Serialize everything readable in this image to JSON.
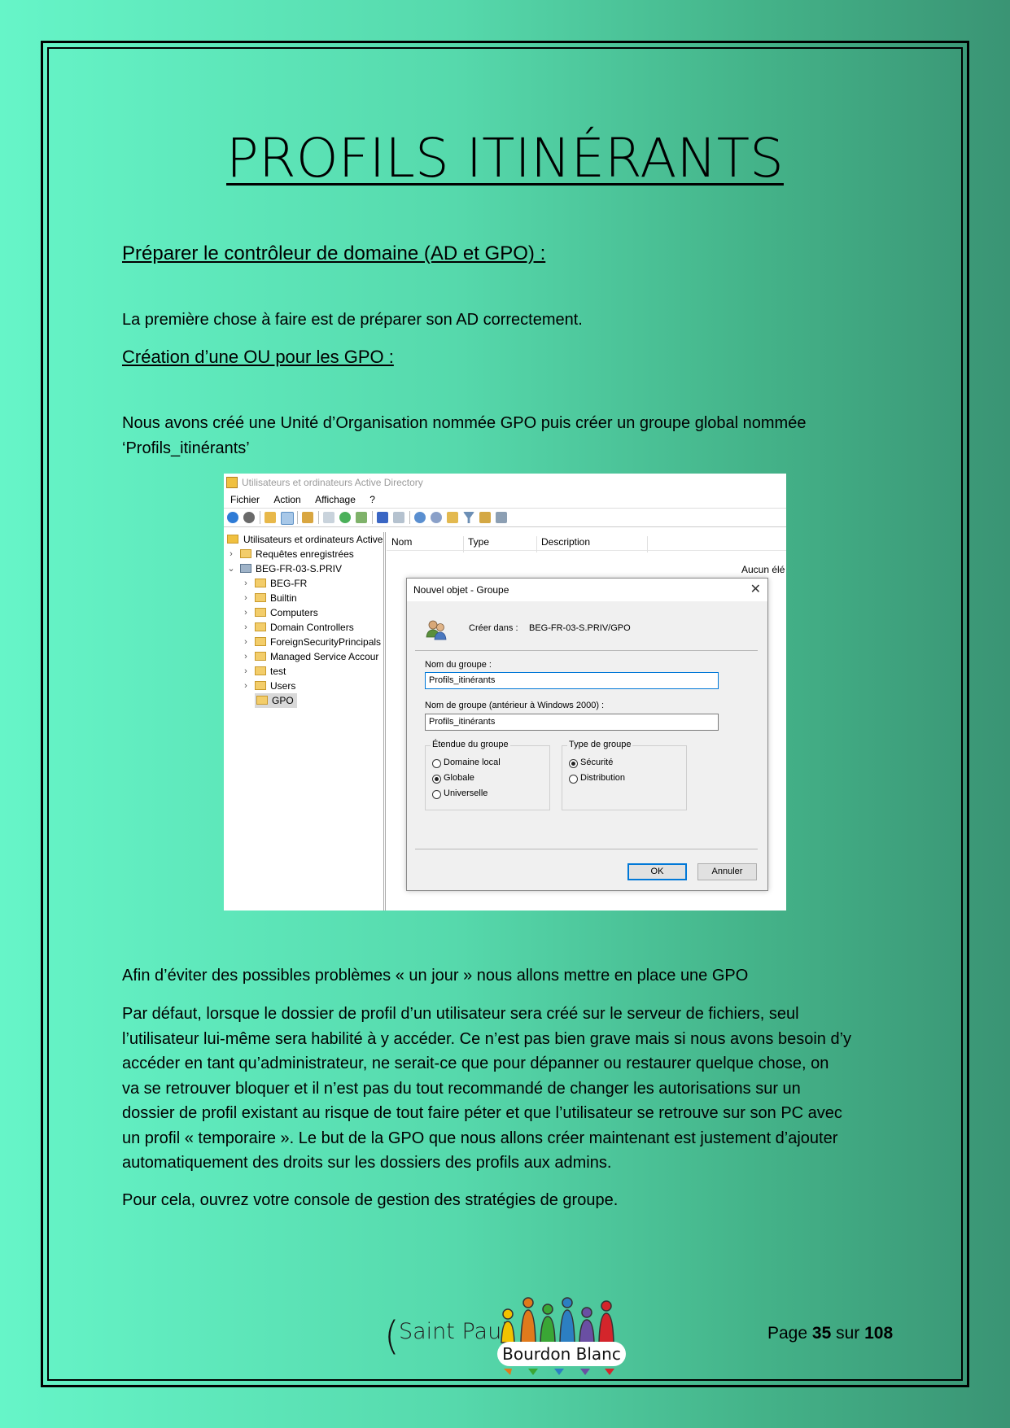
{
  "title": "PROFILS ITINÉRANTS",
  "section_heading": "Préparer le contrôleur de domaine (AD et GPO) :",
  "intro": "La première chose à faire est de préparer son AD correctement.",
  "sub_heading": "Création d’une OU pour les GPO :",
  "ou_text_line1": "Nous avons créé une Unité d’Organisation nommée GPO puis créer un groupe global nommée",
  "ou_text_line2": "‘Profils_itinérants’",
  "screenshot": {
    "window_title": "Utilisateurs et ordinateurs Active Directory",
    "menu": [
      "Fichier",
      "Action",
      "Affichage",
      "?"
    ],
    "tree": {
      "root": "Utilisateurs et ordinateurs Active",
      "saved_queries": "Requêtes enregistrées",
      "domain": "BEG-FR-03-S.PRIV",
      "children": [
        "BEG-FR",
        "Builtin",
        "Computers",
        "Domain Controllers",
        "ForeignSecurityPrincipals",
        "Managed Service Accour",
        "test",
        "Users",
        "GPO"
      ]
    },
    "list_columns": [
      "Nom",
      "Type",
      "Description"
    ],
    "empty_text": "Aucun élé",
    "dialog": {
      "title": "Nouvel objet - Groupe",
      "create_in_label": "Créer dans :",
      "create_in_value": "BEG-FR-03-S.PRIV/GPO",
      "group_name_label": "Nom du groupe :",
      "group_name_value": "Profils_itinérants",
      "group_name_pre2000_label": "Nom de groupe (antérieur à Windows 2000) :",
      "group_name_pre2000_value": "Profils_itinérants",
      "scope_legend": "Étendue du groupe",
      "scope_options": [
        "Domaine local",
        "Globale",
        "Universelle"
      ],
      "scope_selected": "Globale",
      "type_legend": "Type de groupe",
      "type_options": [
        "Sécurité",
        "Distribution"
      ],
      "type_selected": "Sécurité",
      "ok": "OK",
      "cancel": "Annuler"
    }
  },
  "para1": "Afin d’éviter des possibles problèmes « un jour » nous allons mettre en place une GPO",
  "para2_lines": [
    "Par défaut, lorsque le dossier de profil d’un utilisateur sera créé sur le serveur de fichiers, seul",
    "l’utilisateur lui-même sera habilité à y accéder. Ce n’est pas bien grave mais si nous avons besoin d’y",
    "accéder en tant qu’administrateur, ne serait-ce que pour dépanner ou restaurer quelque chose, on",
    "va se retrouver bloquer et il n’est pas du tout recommandé de changer les autorisations sur un",
    "dossier de profil existant au risque de tout faire péter et que l’utilisateur se retrouve sur son PC avec",
    "un profil « temporaire ». Le but de la GPO que nous allons créer maintenant est justement d’ajouter",
    "automatiquement des droits sur les dossiers des profils aux admins."
  ],
  "para3": "Pour cela, ouvrez votre console de gestion des stratégies de groupe.",
  "footer": {
    "paren": "(",
    "school": "Saint Paul",
    "logo_text": "Bourdon Blanc",
    "page_label": "Page",
    "page_number": "35",
    "page_sep": "sur",
    "page_total": "108"
  }
}
